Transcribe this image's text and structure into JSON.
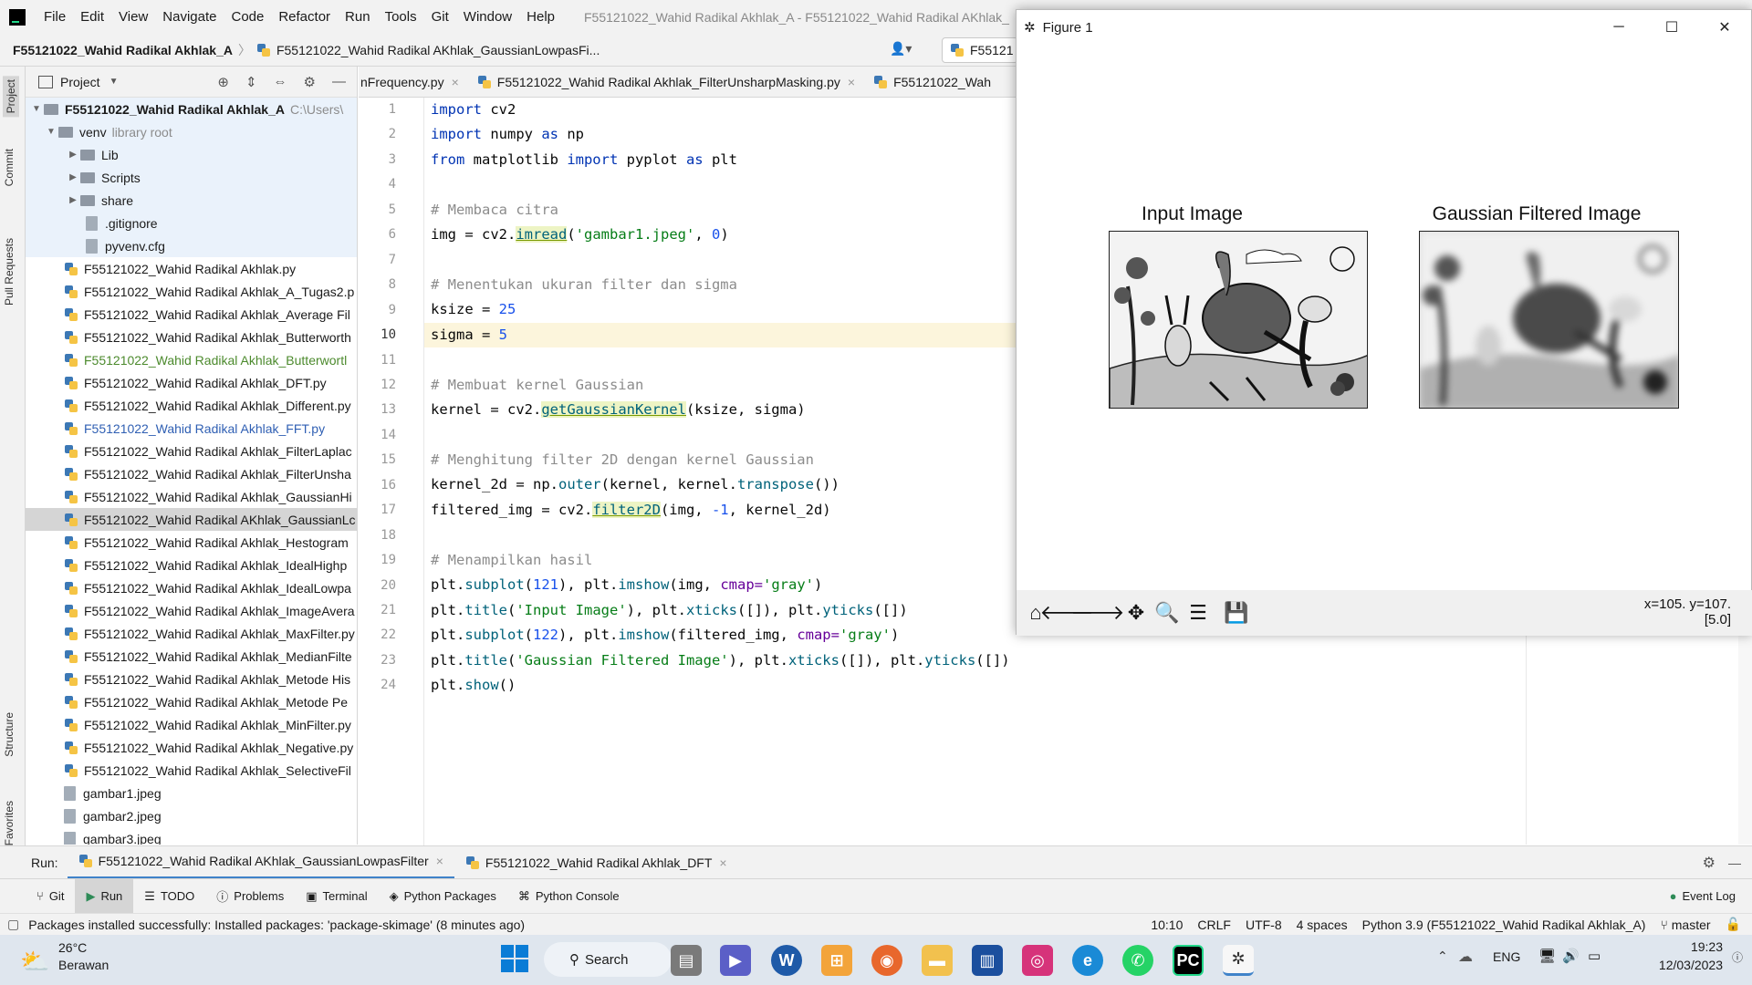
{
  "menubar": {
    "items": [
      "File",
      "Edit",
      "View",
      "Navigate",
      "Code",
      "Refactor",
      "Run",
      "Tools",
      "Git",
      "Window",
      "Help"
    ],
    "window_title": "F55121022_Wahid Radikal Akhlak_A - F55121022_Wahid Radikal AKhlak_"
  },
  "navbar": {
    "project": "F55121022_Wahid Radikal Akhlak_A",
    "file": "F55121022_Wahid Radikal AKhlak_GaussianLowpasFi...",
    "config": "F55121"
  },
  "sidebar": {
    "project_tab": "Project",
    "commit_tab": "Commit",
    "pull_tab": "Pull Requests",
    "structure_tab": "Structure",
    "favorites_tab": "Favorites"
  },
  "project_panel": {
    "header": "Project",
    "root": "F55121022_Wahid Radikal Akhlak_A",
    "root_path": "C:\\Users\\",
    "venv": "venv",
    "venv_note": "library root",
    "venv_children": [
      "Lib",
      "Scripts",
      "share"
    ],
    "venv_files": [
      ".gitignore",
      "pyvenv.cfg"
    ],
    "files": [
      "F55121022_Wahid Radikal Akhlak.py",
      "F55121022_Wahid Radikal Akhlak_A_Tugas2.p",
      "F55121022_Wahid Radikal Akhlak_Average Fil",
      "F55121022_Wahid Radikal Akhlak_Butterworth",
      "F55121022_Wahid Radikal Akhlak_Butterwortl",
      "F55121022_Wahid Radikal Akhlak_DFT.py",
      "F55121022_Wahid Radikal Akhlak_Different.py",
      "F55121022_Wahid Radikal Akhlak_FFT.py",
      "F55121022_Wahid Radikal Akhlak_FilterLaplac",
      "F55121022_Wahid Radikal Akhlak_FilterUnsha",
      "F55121022_Wahid Radikal Akhlak_GaussianHi",
      "F55121022_Wahid Radikal AKhlak_GaussianLc",
      "F55121022_Wahid Radikal Akhlak_Hestogram",
      "F55121022_Wahid Radikal Akhlak_IdealHighp",
      "F55121022_Wahid Radikal Akhlak_IdealLowpa",
      "F55121022_Wahid Radikal Akhlak_ImageAvera",
      "F55121022_Wahid Radikal Akhlak_MaxFilter.py",
      "F55121022_Wahid Radikal Akhlak_MedianFilte",
      "F55121022_Wahid Radikal Akhlak_Metode His",
      "F55121022_Wahid Radikal Akhlak_Metode Pe",
      "F55121022_Wahid Radikal Akhlak_MinFilter.py",
      "F55121022_Wahid Radikal Akhlak_Negative.py",
      "F55121022_Wahid Radikal Akhlak_SelectiveFil",
      "gambar1.jpeg",
      "gambar2.jpeg",
      "gambar3.jpeg"
    ]
  },
  "editor": {
    "tabs": [
      "nFrequency.py",
      "F55121022_Wahid Radikal Akhlak_FilterUnsharpMasking.py",
      "F55121022_Wah"
    ],
    "line_numbers": [
      "1",
      "2",
      "3",
      "4",
      "5",
      "6",
      "7",
      "8",
      "9",
      "10",
      "11",
      "12",
      "13",
      "14",
      "15",
      "16",
      "17",
      "18",
      "19",
      "20",
      "21",
      "22",
      "23",
      "24"
    ],
    "code": {
      "l1a": "import",
      "l1b": " cv2",
      "l2a": "import",
      "l2b": " numpy ",
      "l2c": "as",
      "l2d": " np",
      "l3a": "from",
      "l3b": " matplotlib ",
      "l3c": "import",
      "l3d": " pyplot ",
      "l3e": "as",
      "l3f": " plt",
      "l5": "# Membaca citra",
      "l6a": "img = cv2.",
      "l6b": "imread",
      "l6c": "(",
      "l6d": "'gambar1.jpeg'",
      "l6e": ", ",
      "l6f": "0",
      "l6g": ")",
      "l8": "# Menentukan ukuran filter dan sigma",
      "l9a": "ksize = ",
      "l9b": "25",
      "l10a": "sigma = ",
      "l10b": "5",
      "l12": "# Membuat kernel Gaussian",
      "l13a": "kernel = cv2.",
      "l13b": "getGaussianKernel",
      "l13c": "(ksize, sigma)",
      "l15": "# Menghitung filter 2D dengan kernel Gaussian",
      "l16a": "kernel_2d = np.",
      "l16b": "outer",
      "l16c": "(kernel, kernel.",
      "l16d": "transpose",
      "l16e": "())",
      "l17a": "filtered_img = cv2.",
      "l17b": "filter2D",
      "l17c": "(img, ",
      "l17d": "-1",
      "l17e": ", kernel_2d)",
      "l19": "# Menampilkan hasil",
      "l20a": "plt.",
      "l20b": "subplot",
      "l20c": "(",
      "l20d": "121",
      "l20e": "), plt.",
      "l20f": "imshow",
      "l20g": "(img, ",
      "l20h": "cmap=",
      "l20i": "'gray'",
      "l20j": ")",
      "l21a": "plt.",
      "l21b": "title",
      "l21c": "(",
      "l21d": "'Input Image'",
      "l21e": "), plt.",
      "l21f": "xticks",
      "l21g": "([]), plt.",
      "l21h": "yticks",
      "l21i": "([])",
      "l22a": "plt.",
      "l22b": "subplot",
      "l22c": "(",
      "l22d": "122",
      "l22e": "), plt.",
      "l22f": "imshow",
      "l22g": "(filtered_img, ",
      "l22h": "cmap=",
      "l22i": "'gray'",
      "l22j": ")",
      "l23a": "plt.",
      "l23b": "title",
      "l23c": "(",
      "l23d": "'Gaussian Filtered Image'",
      "l23e": "), plt.",
      "l23f": "xticks",
      "l23g": "([]), plt.",
      "l23h": "yticks",
      "l23i": "([])",
      "l24a": "plt.",
      "l24b": "show",
      "l24c": "()"
    }
  },
  "figure": {
    "title": "Figure 1",
    "subplot1_title": "Input Image",
    "subplot2_title": "Gaussian Filtered Image",
    "coords_line1": "x=105. y=107.",
    "coords_line2": "[5.0]"
  },
  "run_panel": {
    "label": "Run:",
    "tab1": "F55121022_Wahid Radikal AKhlak_GaussianLowpasFilter",
    "tab2": "F55121022_Wahid Radikal Akhlak_DFT"
  },
  "tool_windows": {
    "git": "Git",
    "run": "Run",
    "todo": "TODO",
    "problems": "Problems",
    "terminal": "Terminal",
    "packages": "Python Packages",
    "console": "Python Console",
    "event_log": "Event Log"
  },
  "status": {
    "message": "Packages installed successfully: Installed packages: 'package-skimage' (8 minutes ago)",
    "position": "10:10",
    "line_sep": "CRLF",
    "encoding": "UTF-8",
    "indent": "4 spaces",
    "interpreter": "Python 3.9 (F55121022_Wahid Radikal Akhlak_A)",
    "branch": "master"
  },
  "taskbar": {
    "temp": "26°C",
    "weather": "Berawan",
    "search": "Search",
    "lang": "ENG",
    "time": "19:23",
    "date": "12/03/2023"
  }
}
